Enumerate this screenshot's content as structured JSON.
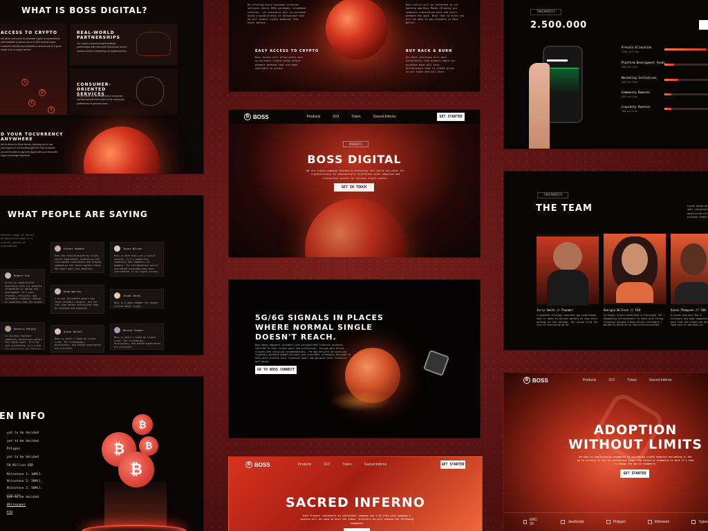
{
  "about": {
    "title": "WHAT IS BOSS DIGITAL?",
    "cards": [
      {
        "title": "ACCESS TO CRYPTO",
        "text": "will allow every user to purchase crypto at convenience and available to almost use it to offer several cases consumer-friendly and available to almost user in a good shape to be a crypto service"
      },
      {
        "title": "REAL-WORLD PARTNERSHIPS",
        "text": "Our crypto company forges strategic partnerships with real-world businesses across various sectors, integrating our cryptocurrency."
      },
      {
        "title": "CONSUMER-ORIENTED SERVICES",
        "text": "We prioritize the development of consumer-oriented services that cater to the needs and preferences of general users."
      },
      {
        "title": "D YOUR TOCURRENCY ANYWHERE",
        "text": "will be linked to Boss Money, allowing you to use your crypto on our banking app then that on places you will be able to pay with crypto with your favourite crypto exchange anywhere."
      }
    ]
  },
  "ease": {
    "col1": "By offering every consumer-oriented services (where QR3s packages, broadband internet, car insurance etc) to purchase using cryptocurrency at discounted rate we will enable crypto adoption like never before.",
    "col2": "Boss wallet will be connected to our banking app Boss Money allowing you seamless transaction back and forth between the apps. Wish that to place you will be able to pay anywhere at Boss Wallet.",
    "left_title": "EASY ACCESS TO CRYPTO",
    "left_text": "Boss Access will allow every user to purchase crypto using secure payment methods that are made available to access.",
    "right_title": "BUY BACK & BURN",
    "right_text": "Our Boss functions will work differently from product where our purchase back will help deflationary cost to create price in our token and will burn."
  },
  "tokenomics": {
    "badge": "TOKENOMICS",
    "total": "2.500.000",
    "rows": [
      {
        "label": "Presale Allocation",
        "amount": "1200 million",
        "pct": 0.85
      },
      {
        "label": "Platform Development Funds",
        "amount": "300 million",
        "pct": 0.2
      },
      {
        "label": "Marketing Initiatives",
        "amount": "400 million",
        "pct": 0.28
      },
      {
        "label": "Community Rewards",
        "amount": "200 million",
        "pct": 0.14
      },
      {
        "label": "Liquidity Reserve",
        "amount": "200 million",
        "pct": 0.14
      }
    ]
  },
  "hero": {
    "logo": "BOSS",
    "logo_sub": "DIGITAL",
    "nav": [
      "Products",
      "ICO",
      "Token",
      "Sacred Inferno"
    ],
    "cta": "GET STARTED",
    "badge": "PRODUCTS",
    "title": "BOSS DIGITAL",
    "text": "We are crypto company focused on providing real world use-cases for cryptocurrency to substantially accelerate wider adoption and transaction growth for various crypto assets.",
    "button": "GET IN TOUCH"
  },
  "testimonials": {
    "title": "WHAT PEOPLE ARE SAYING",
    "left_text": "diverse range of talent perspectives make it a crucial source of information.",
    "people": [
      {
        "name": "Esther Howard",
        "text": "Boss has revolutionized my crypto social experience! Connecting with like-minded individuals and staying updated on the latest market trends has never been this seamless."
      },
      {
        "name": "Jenny Wilson",
        "text": "Boss is more than just a social network; it's a supportive community that empowers its members. The collaborative spirit and shared knowledge have been instrumental in my crypto success."
      },
      {
        "name": "Robert Fox",
        "text": "offers an unparalleled experience with its seamless integration of design and development. It's user-friendly, efficient, and incredibly creative, making it essential tool for anyone looking to quickly bring their to life."
      },
      {
        "name": "Roda Warren",
        "text": "I've met incredible people who share valuable insights, and the real-time market discussions keep me informed and prepared."
      },
      {
        "name": "Jacob Jones",
        "text": "Boss is a game-changer for anyone serious about crypto."
      },
      {
        "name": "Kathryn Murphy",
        "text": "to the Boss Toolbars community connections within the crypto space. It's not just a platform; it's a hub for networking and learning."
      },
      {
        "name": "Diane Russel",
        "text": "Boss is where I found my crypto tribe. The friendships, discussions, and shared experiences are priceless."
      },
      {
        "name": "Bessie Cooper",
        "text": "Boss is where I found my crypto tribe. The friendships, discussions, and shared experiences are priceless."
      }
    ]
  },
  "signals": {
    "title": "5G/6G SIGNALS IN PLACES WHERE NORMAL SINGLE DOESN'T REACH.",
    "text": "Boss Money empowers customers with personalized financial guidance, tailored to their unique goals and preferences. Through data-driven insights and intuitive recommendations, the app delivers personalized financial guidance budgeting tools and investment strategies designed to help users achieve their financial goals and optimize their financial well-being.",
    "button": "GO TO BOSS CONNECT"
  },
  "team": {
    "badge": "TOKENOMICS",
    "title": "THE TEAM",
    "side_text": "Lorem ipsum dolor sit amet consectetur adipiscing elit sed do eiusmod tempor",
    "members": [
      {
        "name": "Jerry Smith // Founder",
        "bio": "A seasoned strategic operator who understands what it takes to disrupt markets as they start working for the consumer. His vision is at the core of everything we do."
      },
      {
        "name": "Georgia Willson // CEO",
        "bio": "Strategic Growth Consultant & Fractional CFO | Empowering Entrepreneurs to Scale with Strong Financial Insight & Data-Driven Strategies | Worked At Deloitte As Chartered Accountant"
      },
      {
        "name": "Susan Thompson // COO",
        "bio": "A proven operator and a visionary who make companies work from the inside and always take care of and move on."
      }
    ]
  },
  "token_info": {
    "title": "EN INFO",
    "rows": [
      "yet to be decided",
      "yet to be decided",
      "Polygon",
      "yet to be decided",
      "50 Million USD",
      "Milestone 1: 10Mil.",
      "Milestone 2: 20Mil.",
      "Milestone 3: 50Mil.",
      "yet to be decided"
    ],
    "links": [
      "UTILITY",
      "Whitepaper",
      "FAQ"
    ]
  },
  "inferno": {
    "nav": [
      "Products",
      "ICO",
      "Token",
      "Sacred Inferno"
    ],
    "cta": "GET STARTED",
    "title": "SACRED INFERNO",
    "text": "Each Project represents an individual company and 1.5% from each company's revenue will be used to burn the token. Initially we will expand the following companies"
  },
  "adoption": {
    "nav": [
      "Products",
      "ICO",
      "Token",
      "Sacred Inferno"
    ],
    "title_line1": "ADOPTION",
    "title_line2": "WITHOUT LIMITS",
    "text": "We want to revolutionize ecommerce by increasing crypto adoption and making it the go-to currency to use for purchasing items. The future of ecommerce is here it's time to change the way of ecommerce.",
    "button": "GET STARTED",
    "tech": [
      "ERC-20",
      "JavaScript",
      "Polygon",
      "Ethereum",
      "Typescript"
    ]
  },
  "colors": {
    "accent": "#e0432d",
    "bg": "#0b0606",
    "outer": "#5a1414"
  }
}
